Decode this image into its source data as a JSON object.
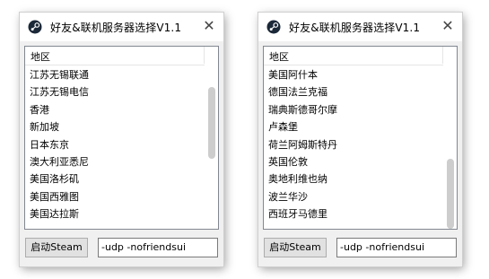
{
  "windows": [
    {
      "title": "好友&联机服务器选择V1.1",
      "column_header": "地区",
      "rows": [
        "江苏无锡联通",
        "江苏无锡电信",
        "香港",
        "新加坡",
        "日本东京",
        "澳大利亚悉尼",
        "美国洛杉矶",
        "美国西雅图",
        "美国达拉斯"
      ],
      "start_button": "启动Steam",
      "args_value": "-udp -nofriendsui",
      "close_glyph": "✕",
      "logo_icon": "steam-logo-icon"
    },
    {
      "title": "好友&联机服务器选择V1.1",
      "column_header": "地区",
      "rows": [
        "美国阿什本",
        "德国法兰克福",
        "瑞典斯德哥尔摩",
        "卢森堡",
        "荷兰阿姆斯特丹",
        "英国伦敦",
        "奥地利维也纳",
        "波兰华沙",
        "西班牙马德里"
      ],
      "start_button": "启动Steam",
      "args_value": "-udp -nofriendsui",
      "close_glyph": "✕",
      "logo_icon": "steam-logo-icon"
    }
  ],
  "colors": {
    "window_bg": "#f0f0f0",
    "button_bg": "#e1e1e1",
    "scroll_thumb": "#cdcdcd",
    "logo": "#1b2838"
  }
}
